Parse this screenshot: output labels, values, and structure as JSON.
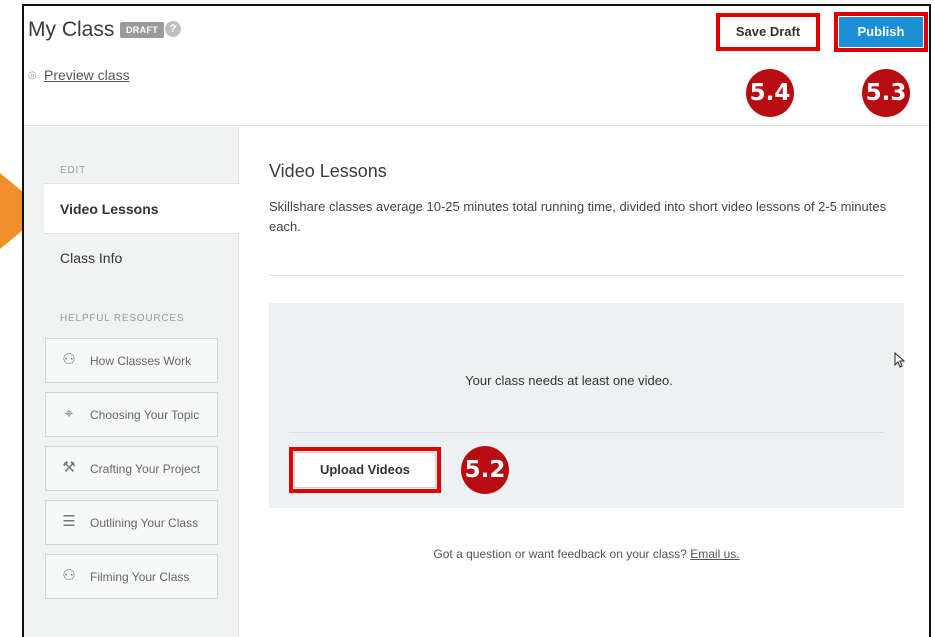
{
  "header": {
    "title": "My Class",
    "badge": "DRAFT",
    "help_icon": "?",
    "preview_link": "Preview class",
    "save_draft_label": "Save Draft",
    "publish_label": "Publish"
  },
  "steps": {
    "save_draft": "5.4",
    "publish": "5.3",
    "upload": "5.2"
  },
  "sidebar": {
    "edit_heading": "EDIT",
    "items": [
      {
        "label": "Video Lessons",
        "active": true
      },
      {
        "label": "Class Info",
        "active": false
      }
    ],
    "resources_heading": "HELPFUL RESOURCES",
    "resources": [
      {
        "label": "How Classes Work",
        "icon": "camera-people-icon"
      },
      {
        "label": "Choosing Your Topic",
        "icon": "location-pin-icon"
      },
      {
        "label": "Crafting Your Project",
        "icon": "tools-icon"
      },
      {
        "label": "Outlining Your Class",
        "icon": "list-icon"
      },
      {
        "label": "Filming Your Class",
        "icon": "camera-people-icon"
      }
    ]
  },
  "main": {
    "title": "Video Lessons",
    "description": "Skillshare classes average 10-25 minutes total running time, divided into short video lessons of 2-5 minutes each.",
    "panel_message": "Your class needs at least one video.",
    "upload_label": "Upload Videos",
    "feedback_text": "Got a question or want feedback on your class?",
    "feedback_link": "Email us."
  },
  "colors": {
    "publish": "#1c8fd6",
    "highlight": "#e00000",
    "step_marker": "#b80c10",
    "arrow": "#f0902a"
  }
}
